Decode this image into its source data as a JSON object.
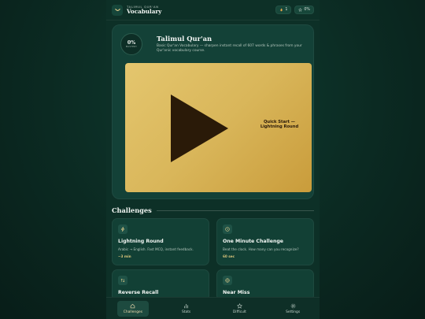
{
  "header": {
    "brand_sub": "TALIMUL QUR'AN",
    "brand_title": "Vocabulary",
    "streak_count": "1",
    "xp_label": "0%"
  },
  "hero": {
    "mastery_value": "0%",
    "mastery_label": "MASTERY",
    "title": "Talimul Qur'an",
    "description": "Basic Qur'an Vocabulary — sharpen instant recall of 607 words & phrases from your Qur'anic vocabulary course.",
    "video_label_line1": "Quick Start —",
    "video_label_line2": "Lightning Round"
  },
  "challenges": {
    "heading": "Challenges",
    "items": [
      {
        "title": "Lightning Round",
        "description": "Arabic → English. Fast MCQ, instant feedback.",
        "meta": "~3 min",
        "icon": "lightning-icon"
      },
      {
        "title": "One Minute Challenge",
        "description": "Beat the clock. How many can you recognize?",
        "meta": "60 sec",
        "icon": "clock-icon"
      },
      {
        "title": "Reverse Recall",
        "description": "",
        "meta": "",
        "icon": "swap-icon"
      },
      {
        "title": "Near Miss",
        "description": "",
        "meta": "",
        "icon": "target-icon"
      }
    ]
  },
  "nav": {
    "items": [
      {
        "label": "Challenges",
        "icon": "home-icon",
        "active": true
      },
      {
        "label": "Stats",
        "icon": "bar-chart-icon",
        "active": false
      },
      {
        "label": "Difficult",
        "icon": "star-icon",
        "active": false
      },
      {
        "label": "Settings",
        "icon": "gear-icon",
        "active": false
      }
    ]
  },
  "colors": {
    "background": "#0b2a22",
    "card": "#134137",
    "gold": "#d9b65a",
    "accent_text": "#d8c37a"
  }
}
